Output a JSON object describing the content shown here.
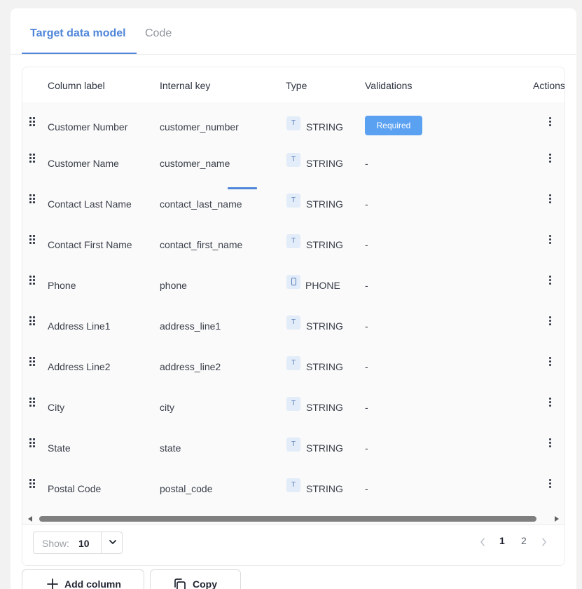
{
  "tabs": [
    {
      "label": "Target data model",
      "active": true
    },
    {
      "label": "Code",
      "active": false
    }
  ],
  "table": {
    "headers": {
      "column_label": "Column label",
      "internal_key": "Internal key",
      "type": "Type",
      "validations": "Validations",
      "actions": "Actions"
    },
    "rows": [
      {
        "label": "Customer Number",
        "key": "customer_number",
        "type": "STRING",
        "type_icon": "T",
        "validation": "Required"
      },
      {
        "label": "Customer Name",
        "key": "customer_name",
        "type": "STRING",
        "type_icon": "T",
        "validation": "-"
      },
      {
        "label": "Contact Last Name",
        "key": "contact_last_name",
        "type": "STRING",
        "type_icon": "T",
        "validation": "-"
      },
      {
        "label": "Contact First Name",
        "key": "contact_first_name",
        "type": "STRING",
        "type_icon": "T",
        "validation": "-"
      },
      {
        "label": "Phone",
        "key": "phone",
        "type": "PHONE",
        "type_icon": "phone-icon",
        "validation": "-"
      },
      {
        "label": "Address Line1",
        "key": "address_line1",
        "type": "STRING",
        "type_icon": "T",
        "validation": "-"
      },
      {
        "label": "Address Line2",
        "key": "address_line2",
        "type": "STRING",
        "type_icon": "T",
        "validation": "-"
      },
      {
        "label": "City",
        "key": "city",
        "type": "STRING",
        "type_icon": "T",
        "validation": "-"
      },
      {
        "label": "State",
        "key": "state",
        "type": "STRING",
        "type_icon": "T",
        "validation": "-"
      },
      {
        "label": "Postal Code",
        "key": "postal_code",
        "type": "STRING",
        "type_icon": "T",
        "validation": "-"
      }
    ]
  },
  "footer": {
    "show_label": "Show:",
    "show_value": "10",
    "pages": [
      "1",
      "2"
    ],
    "current_page": "1"
  },
  "buttons": {
    "add_column": "Add column",
    "copy": "Copy"
  },
  "colors": {
    "accent": "#4f86d9",
    "badge": "#5aa1f2",
    "type_icon_bg": "#e3ecf9"
  }
}
